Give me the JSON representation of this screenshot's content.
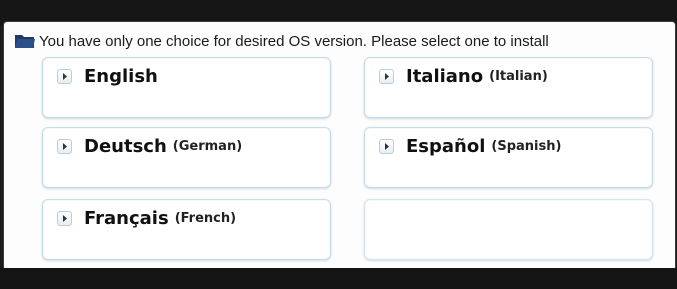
{
  "header": {
    "text": "You have only one choice for desired OS version. Please select one to install",
    "icon": "folder-icon"
  },
  "languages": [
    {
      "name": "English",
      "sub": ""
    },
    {
      "name": "Italiano",
      "sub": "(Italian)"
    },
    {
      "name": "Deutsch",
      "sub": "(German)"
    },
    {
      "name": "Español",
      "sub": "(Spanish)"
    },
    {
      "name": "Français",
      "sub": "(French)"
    }
  ],
  "colors": {
    "accent_border": "#c8dce6",
    "text": "#111111",
    "background": "#fdfdfd"
  }
}
